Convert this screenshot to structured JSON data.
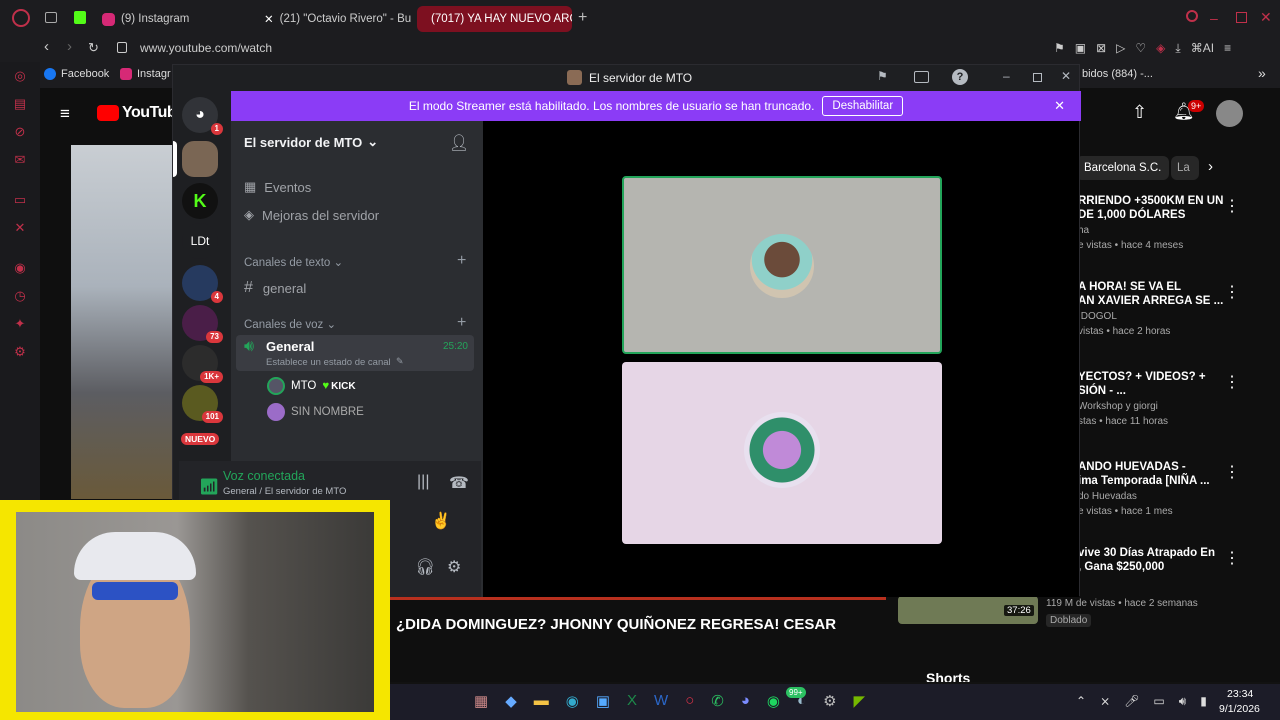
{
  "browser": {
    "tabs": [
      {
        "label": "(9) Instagram"
      },
      {
        "label": "(21) \"Octavio Rivero\" - Bu"
      },
      {
        "label": "(7017) YA HAY NUEVO ARG"
      }
    ],
    "url": "www.youtube.com/watch",
    "bookmarks": [
      "Facebook",
      "Instagr"
    ],
    "right_bookmark": "bidos (884) -..."
  },
  "youtube": {
    "logo": "YouTube",
    "chips": [
      "Barcelona S.C.",
      "La"
    ],
    "notif_count": "9+",
    "video_title": "¿DIDA DOMINGUEZ? JHONNY QUIÑONEZ REGRESA! CESAR",
    "shorts_label": "Shorts",
    "recs": [
      {
        "title1": "RRIENDO +3500KM EN UN",
        "title2": "DE 1,000 DÓLARES",
        "channel": "ha",
        "meta": "e vistas • hace 4 meses"
      },
      {
        "title1": "A HORA! SE VA EL",
        "title2": "AN XAVIER ARREGA SE ...",
        "channel": "IDOGOL",
        "meta": "vistas • hace 2 horas"
      },
      {
        "title1": "YECTOS? + VIDEOS? +",
        "title2": "SIÓN  -  ...",
        "channel": "Workshop y giorgi",
        "meta": "stas • hace 11 horas"
      },
      {
        "title1": "ANDO HUEVADAS -",
        "title2": "ima Temporada [NIÑA ...",
        "channel": "do Huevadas",
        "meta": "e vistas • hace 1 mes"
      },
      {
        "title1": "vive 30 Días Atrapado En",
        "title2": ", Gana $250,000",
        "channel": "",
        "meta": "119 M de vistas • hace 2 semanas"
      }
    ],
    "duration": "37:26",
    "dubbed": "Doblado"
  },
  "discord": {
    "window_title": "El servidor de MTO",
    "streamer_banner": "El modo Streamer está habilitado. Los nombres de usuario se han truncado.",
    "disable_button": "Deshabilitar",
    "server_name": "El servidor de MTO",
    "events": "Eventos",
    "boosts": "Mejoras del servidor",
    "text_category": "Canales de texto",
    "text_channel": "general",
    "voice_category": "Canales de voz",
    "voice_channel": "General",
    "voice_timer": "25:20",
    "voice_status": "Establece un estado de canal",
    "members": [
      {
        "name": "MTO",
        "tag": "KICK"
      },
      {
        "name": "SIN NOMBRE",
        "tag": ""
      }
    ],
    "connected_title": "Voz conectada",
    "connected_sub": "General / El servidor de MTO",
    "server_badges": [
      "1",
      "4",
      "73",
      "1K+",
      "101"
    ],
    "server_label_ld": "LDt",
    "new_label": "NUEVO"
  },
  "taskbar": {
    "time": "23:34",
    "date": "9/1/2026",
    "whatsapp_badge": "99+"
  },
  "colors": {
    "discord_blurple": "#8b3cf6",
    "voice_green": "#23a55a",
    "browser_accent": "#c0304a"
  }
}
